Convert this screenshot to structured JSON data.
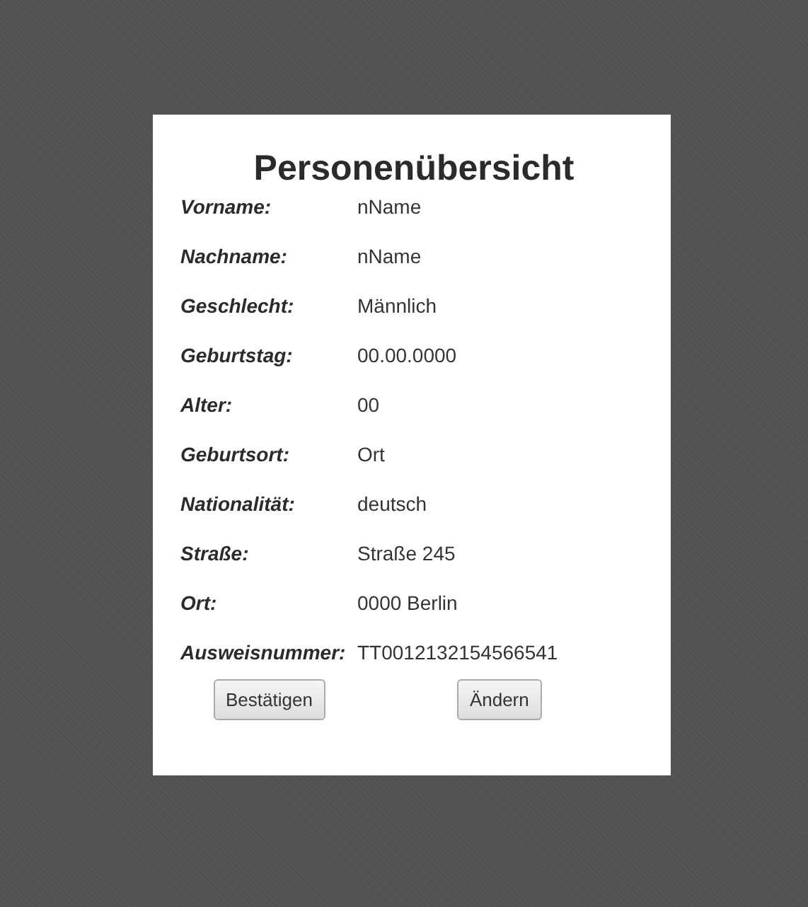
{
  "title": "Personenübersicht",
  "fields": [
    {
      "label": "Vorname:",
      "value": "nName"
    },
    {
      "label": "Nachname:",
      "value": "nName"
    },
    {
      "label": "Geschlecht:",
      "value": "Männlich"
    },
    {
      "label": "Geburtstag:",
      "value": "00.00.0000"
    },
    {
      "label": "Alter:",
      "value": "00"
    },
    {
      "label": "Geburtsort:",
      "value": "Ort"
    },
    {
      "label": "Nationalität:",
      "value": "deutsch"
    },
    {
      "label": "Straße:",
      "value": "Straße 245"
    },
    {
      "label": "Ort:",
      "value": "0000 Berlin"
    },
    {
      "label": "Ausweisnummer:",
      "value": "TT0012132154566541"
    }
  ],
  "buttons": [
    "Bestätigen",
    "Ändern"
  ]
}
